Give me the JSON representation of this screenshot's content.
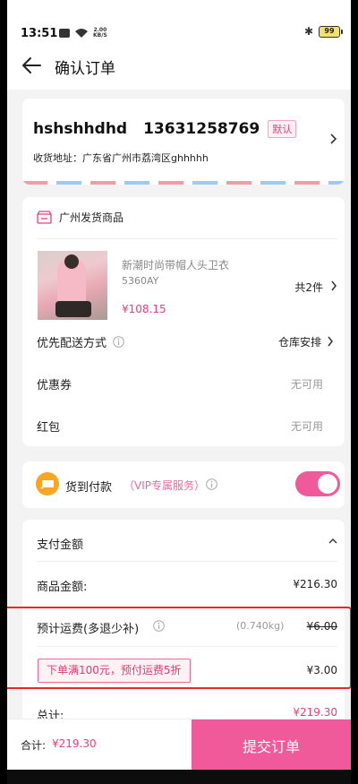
{
  "status_bar": {
    "time": "13:51",
    "speed": "2.00\nKB/S",
    "bluetooth_icon": "bluetooth-icon",
    "battery": "99"
  },
  "header": {
    "title": "确认订单",
    "back_icon": "back-arrow-icon"
  },
  "address": {
    "name": "hshshhdhd",
    "phone": "13631258769",
    "badge": "默认",
    "label": "收货地址：广东省广州市荔湾区ghhhhh"
  },
  "goods": {
    "store": "广州发货商品",
    "title": "新潮时尚带帽人头卫衣",
    "sku": "5360AY",
    "price": "¥108.15",
    "count": "共2件"
  },
  "options": {
    "delivery_label": "优先配送方式",
    "delivery_value": "仓库安排",
    "coupon_label": "优惠券",
    "coupon_value": "无可用",
    "redpacket_label": "红包",
    "redpacket_value": "无可用"
  },
  "cod": {
    "label": "货到付款",
    "vip": "（VIP专属服务）",
    "enabled": true
  },
  "payment": {
    "title": "支付金额",
    "goods_label": "商品金额:",
    "goods_value": "¥216.30",
    "shipping_label": "预计运费(多退少补)",
    "shipping_weight": "(0.740kg)",
    "shipping_original": "¥6.00",
    "promo_text": "下单满100元，预付运费5折",
    "promo_value": "¥3.00",
    "total_label": "总计:",
    "total_value": "¥219.30"
  },
  "bottom_bar": {
    "sum_label": "合计:",
    "sum_value": "¥219.30",
    "submit_label": "提交订单"
  },
  "colors": {
    "accent": "#f05a9b",
    "price": "#e8407b",
    "highlight_box": "#e52a2a"
  }
}
